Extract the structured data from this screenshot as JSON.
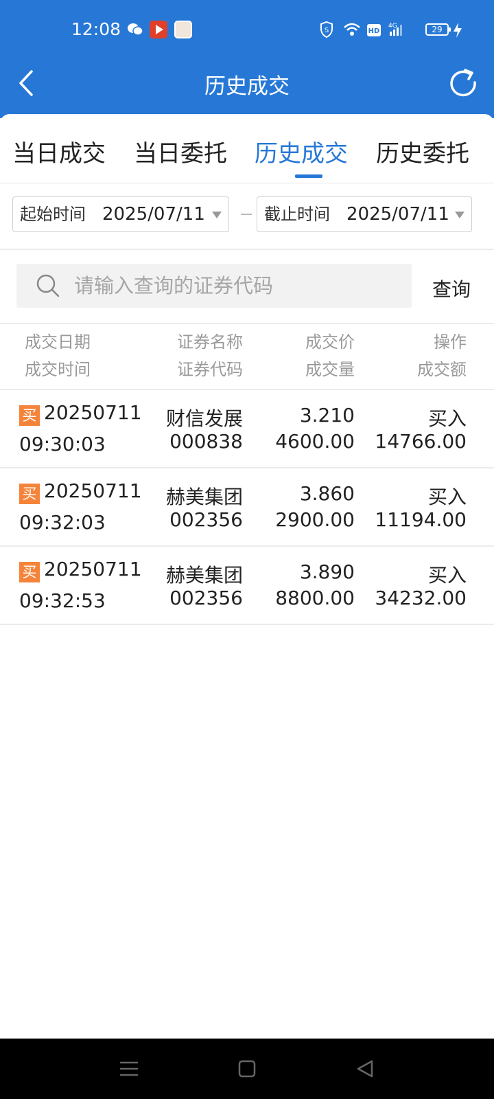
{
  "status_bar": {
    "time": "12:08",
    "icons": [
      "wechat-icon",
      "video-app-icon",
      "avatar-app-icon",
      "shield-icon",
      "wifi-icon",
      "hd-icon",
      "signal-4g-icon"
    ],
    "battery": "29"
  },
  "header": {
    "title": "历史成交",
    "back_icon": "chevron-left-icon",
    "refresh_icon": "refresh-icon",
    "color": "#2778d6"
  },
  "tabs": [
    {
      "label": "当日成交",
      "active": false
    },
    {
      "label": "当日委托",
      "active": false
    },
    {
      "label": "历史成交",
      "active": true
    },
    {
      "label": "历史委托",
      "active": false
    }
  ],
  "date_filter": {
    "start_label": "起始时间",
    "start_value": "2025/07/11",
    "end_label": "截止时间",
    "end_value": "2025/07/11"
  },
  "search": {
    "placeholder": "请输入查询的证券代码",
    "query_label": "查询"
  },
  "table": {
    "headers": {
      "col1_line1": "成交日期",
      "col1_line2": "成交时间",
      "col2_line1": "证券名称",
      "col2_line2": "证券代码",
      "col3_line1": "成交价",
      "col3_line2": "成交量",
      "col4_line1": "操作",
      "col4_line2": "成交额"
    },
    "rows": [
      {
        "badge": "买",
        "date": "20250711",
        "time": "09:30:03",
        "name": "财信发展",
        "code": "000838",
        "price": "3.210",
        "volume": "4600.00",
        "action": "买入",
        "amount": "14766.00"
      },
      {
        "badge": "买",
        "date": "20250711",
        "time": "09:32:03",
        "name": "赫美集团",
        "code": "002356",
        "price": "3.860",
        "volume": "2900.00",
        "action": "买入",
        "amount": "11194.00"
      },
      {
        "badge": "买",
        "date": "20250711",
        "time": "09:32:53",
        "name": "赫美集团",
        "code": "002356",
        "price": "3.890",
        "volume": "8800.00",
        "action": "买入",
        "amount": "34232.00"
      }
    ],
    "badge_color": "#f5843a"
  },
  "system_nav": {
    "icons": [
      "menu-icon",
      "home-square-icon",
      "back-triangle-icon"
    ]
  }
}
